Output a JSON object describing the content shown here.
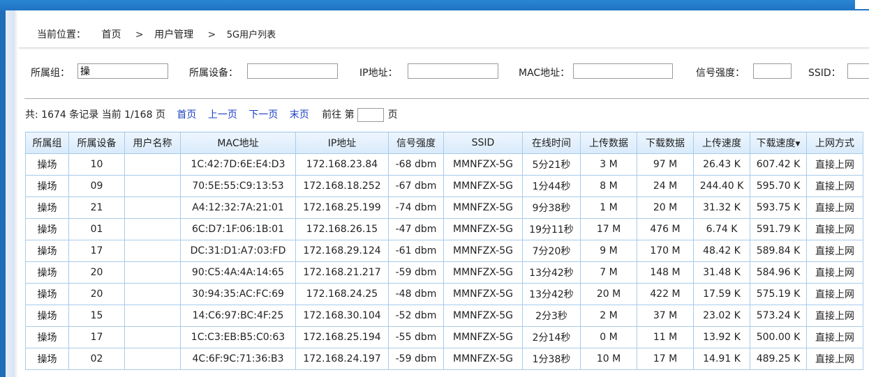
{
  "breadcrumb": {
    "label": "当前位置：",
    "items": [
      "首页",
      "用户管理",
      "5G用户列表"
    ],
    "separator": ">"
  },
  "filters": {
    "group_label": "所属组：",
    "group_value": "操",
    "device_label": "所属设备：",
    "device_value": "",
    "ip_label": "IP地址：",
    "ip_value": "",
    "mac_label": "MAC地址：",
    "mac_value": "",
    "signal_label": "信号强度：",
    "signal_value": "",
    "ssid_label": "SSID："
  },
  "pager": {
    "summary": "共: 1674 条记录 当前 1/168 页",
    "first": "首页",
    "prev": "上一页",
    "next": "下一页",
    "last": "末页",
    "goto_prefix": "前往 第",
    "goto_suffix": "页"
  },
  "table": {
    "sort_indicator": "▼",
    "columns": [
      "所属组",
      "所属设备",
      "用户名称",
      "MAC地址",
      "IP地址",
      "信号强度",
      "SSID",
      "在线时间",
      "上传数据",
      "下载数据",
      "上传速度",
      "下载速度",
      "上网方式"
    ],
    "rows": [
      [
        "操场",
        "10",
        "",
        "1C:42:7D:6E:E4:D3",
        "172.168.23.84",
        "-68 dbm",
        "MMNFZX-5G",
        "5分21秒",
        "3 M",
        "97 M",
        "26.43 K",
        "607.42 K",
        "直接上网"
      ],
      [
        "操场",
        "09",
        "",
        "70:5E:55:C9:13:53",
        "172.168.18.252",
        "-67 dbm",
        "MMNFZX-5G",
        "1分44秒",
        "8 M",
        "24 M",
        "244.40 K",
        "595.70 K",
        "直接上网"
      ],
      [
        "操场",
        "21",
        "",
        "A4:12:32:7A:21:01",
        "172.168.25.199",
        "-74 dbm",
        "MMNFZX-5G",
        "9分38秒",
        "1 M",
        "20 M",
        "31.32 K",
        "593.75 K",
        "直接上网"
      ],
      [
        "操场",
        "01",
        "",
        "6C:D7:1F:06:1B:01",
        "172.168.26.15",
        "-47 dbm",
        "MMNFZX-5G",
        "19分11秒",
        "17 M",
        "476 M",
        "6.74 K",
        "591.79 K",
        "直接上网"
      ],
      [
        "操场",
        "17",
        "",
        "DC:31:D1:A7:03:FD",
        "172.168.29.124",
        "-61 dbm",
        "MMNFZX-5G",
        "7分20秒",
        "9 M",
        "170 M",
        "48.42 K",
        "589.84 K",
        "直接上网"
      ],
      [
        "操场",
        "20",
        "",
        "90:C5:4A:4A:14:65",
        "172.168.21.217",
        "-59 dbm",
        "MMNFZX-5G",
        "13分42秒",
        "7 M",
        "148 M",
        "31.48 K",
        "584.96 K",
        "直接上网"
      ],
      [
        "操场",
        "20",
        "",
        "30:94:35:AC:FC:69",
        "172.168.24.25",
        "-48 dbm",
        "MMNFZX-5G",
        "13分42秒",
        "20 M",
        "422 M",
        "17.59 K",
        "575.19 K",
        "直接上网"
      ],
      [
        "操场",
        "15",
        "",
        "14:C6:97:BC:4F:25",
        "172.168.30.104",
        "-52 dbm",
        "MMNFZX-5G",
        "2分3秒",
        "2 M",
        "37 M",
        "23.02 K",
        "573.24 K",
        "直接上网"
      ],
      [
        "操场",
        "17",
        "",
        "1C:C3:EB:B5:C0:63",
        "172.168.25.194",
        "-55 dbm",
        "MMNFZX-5G",
        "2分14秒",
        "0 M",
        "11 M",
        "13.92 K",
        "500.00 K",
        "直接上网"
      ],
      [
        "操场",
        "02",
        "",
        "4C:6F:9C:71:36:B3",
        "172.168.24.197",
        "-59 dbm",
        "MMNFZX-5G",
        "1分38秒",
        "10 M",
        "17 M",
        "14.91 K",
        "489.25 K",
        "直接上网"
      ]
    ]
  }
}
